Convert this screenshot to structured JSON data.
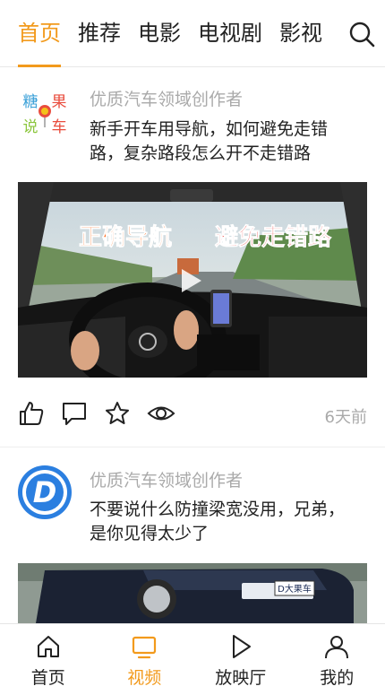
{
  "top_tabs": {
    "items": [
      {
        "label": "首页",
        "active": true
      },
      {
        "label": "推荐"
      },
      {
        "label": "电影"
      },
      {
        "label": "电视剧"
      },
      {
        "label": "影视"
      }
    ],
    "search_icon": "search-icon",
    "accent_color": "#f29a1c"
  },
  "feed": [
    {
      "author": "优质汽车领域创作者",
      "avatar_text": [
        "糖",
        "果",
        "说",
        "车"
      ],
      "title": "新手开车用导航，如何避免走错路，复杂路段怎么开不走错路",
      "thumbnail_caption_left": "正确导航",
      "thumbnail_caption_right": "避免走错路",
      "time": "6天前",
      "actions": [
        "like-icon",
        "comment-icon",
        "star-icon",
        "view-icon"
      ]
    },
    {
      "author": "优质汽车领域创作者",
      "avatar_text": "D",
      "title": "不要说什么防撞梁宽没用，兄弟，是你见得太少了",
      "thumbnail_plate": "D大果车"
    }
  ],
  "bottom_nav": {
    "items": [
      {
        "label": "首页",
        "icon": "home-icon"
      },
      {
        "label": "视频",
        "icon": "video-icon",
        "active": true
      },
      {
        "label": "放映厅",
        "icon": "play-icon"
      },
      {
        "label": "我的",
        "icon": "user-icon"
      }
    ]
  }
}
